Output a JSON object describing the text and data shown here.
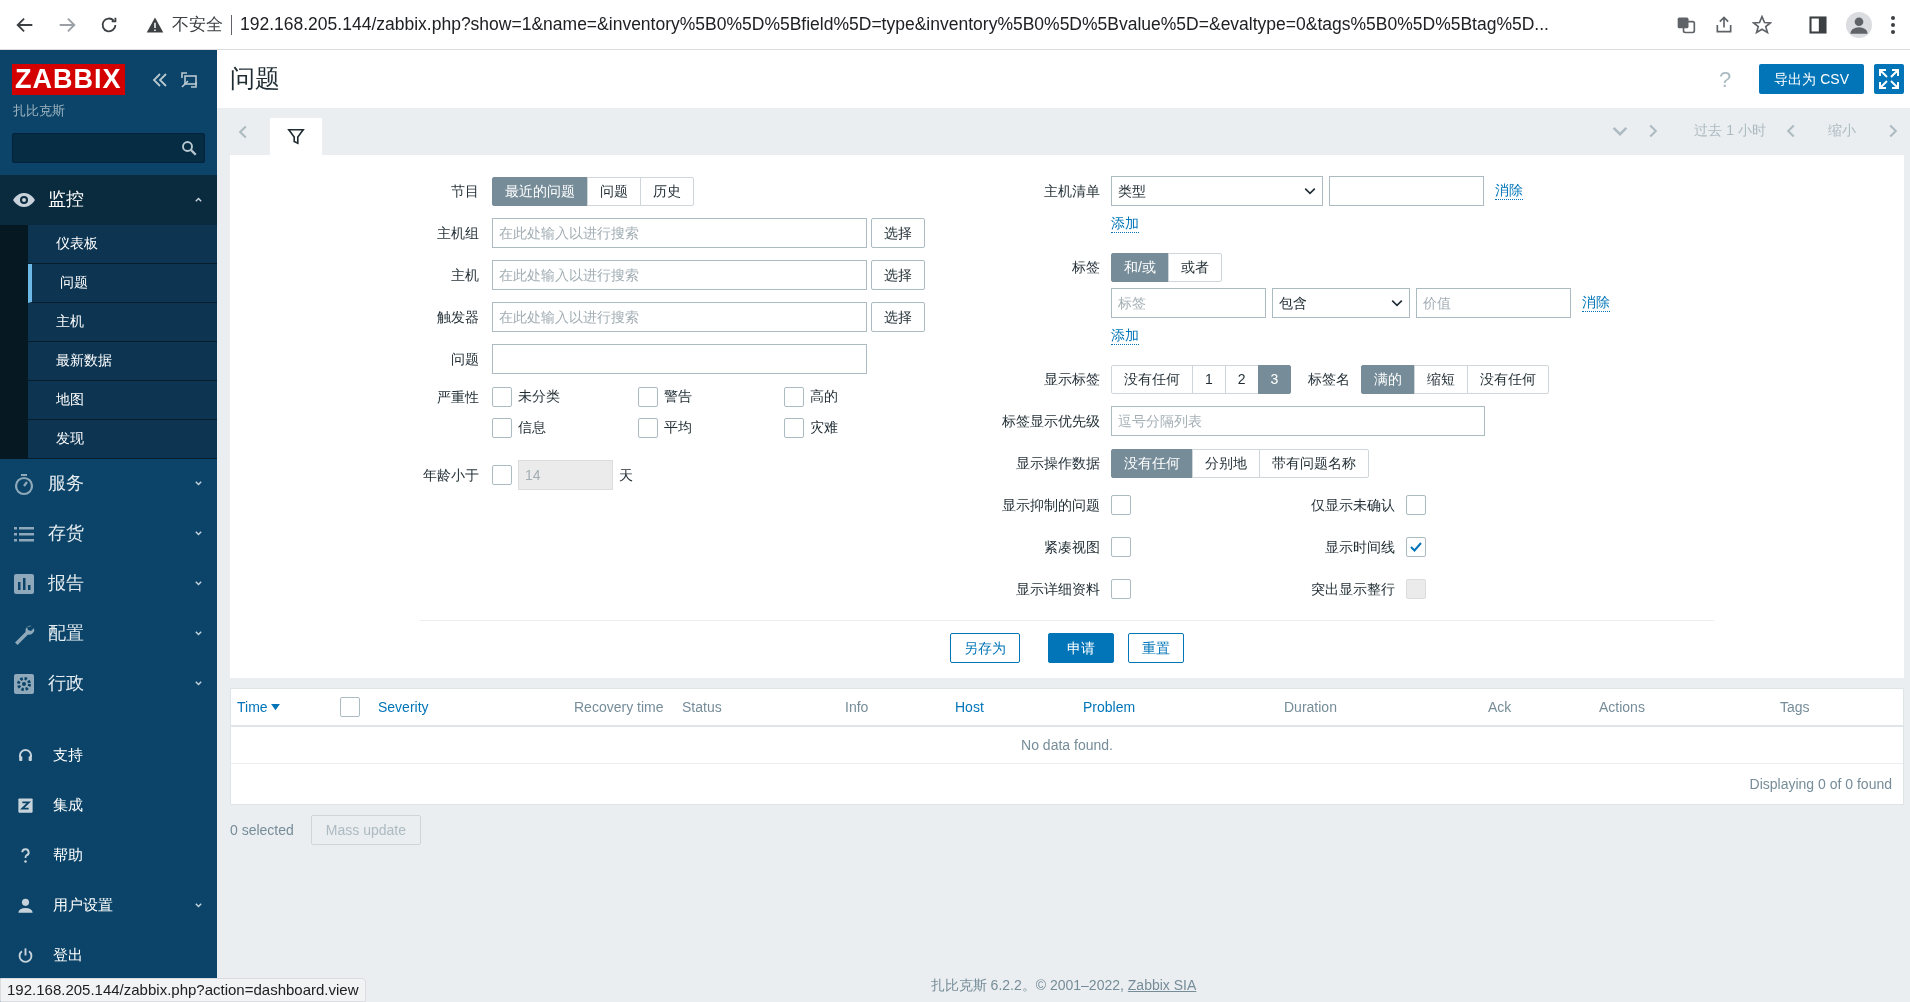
{
  "browser": {
    "security_label": "不安全",
    "url": "192.168.205.144/zabbix.php?show=1&name=&inventory%5B0%5D%5Bfield%5D=type&inventory%5B0%5D%5Bvalue%5D=&evaltype=0&tags%5B0%5D%5Btag%5D..."
  },
  "sidebar": {
    "logo": "ZABBIX",
    "subtitle": "扎比克斯",
    "menu": [
      {
        "label": "监控",
        "expanded": true,
        "children": [
          {
            "label": "仪表板",
            "selected": false
          },
          {
            "label": "问题",
            "selected": true
          },
          {
            "label": "主机",
            "selected": false
          },
          {
            "label": "最新数据",
            "selected": false
          },
          {
            "label": "地图",
            "selected": false
          },
          {
            "label": "发现",
            "selected": false
          }
        ]
      },
      {
        "label": "服务",
        "expanded": false
      },
      {
        "label": "存货",
        "expanded": false
      },
      {
        "label": "报告",
        "expanded": false
      },
      {
        "label": "配置",
        "expanded": false
      },
      {
        "label": "行政",
        "expanded": false
      }
    ],
    "bottom": [
      {
        "label": "支持"
      },
      {
        "label": "集成"
      },
      {
        "label": "帮助"
      },
      {
        "label": "用户设置",
        "expanded": false
      },
      {
        "label": "登出"
      }
    ]
  },
  "header": {
    "title": "问题",
    "help": "?",
    "export_button": "导出为 CSV"
  },
  "timeline": {
    "period": "过去 1 小时",
    "zoom_out": "缩小"
  },
  "filter": {
    "left": {
      "show": {
        "label": "节目",
        "options": [
          {
            "label": "最近的问题",
            "selected": true
          },
          {
            "label": "问题",
            "selected": false
          },
          {
            "label": "历史",
            "selected": false
          }
        ]
      },
      "multiselects": [
        {
          "label": "主机组",
          "placeholder": "在此处输入以进行搜索",
          "button": "选择"
        },
        {
          "label": "主机",
          "placeholder": "在此处输入以进行搜索",
          "button": "选择"
        },
        {
          "label": "触发器",
          "placeholder": "在此处输入以进行搜索",
          "button": "选择"
        }
      ],
      "problem": {
        "label": "问题"
      },
      "severity": {
        "label": "严重性",
        "options": [
          {
            "label": "未分类",
            "checked": false
          },
          {
            "label": "警告",
            "checked": false
          },
          {
            "label": "高的",
            "checked": false
          },
          {
            "label": "信息",
            "checked": false
          },
          {
            "label": "平均",
            "checked": false
          },
          {
            "label": "灾难",
            "checked": false
          }
        ]
      },
      "age": {
        "label": "年龄小于",
        "checked": false,
        "value": "14",
        "unit": "天"
      }
    },
    "right": {
      "inventory": {
        "label": "主机清单",
        "field": "类型",
        "remove": "消除",
        "add": "添加"
      },
      "tags": {
        "label": "标签",
        "evaltype": [
          {
            "label": "和/或",
            "selected": true
          },
          {
            "label": "或者",
            "selected": false
          }
        ],
        "tag_placeholder": "标签",
        "operator": "包含",
        "value_placeholder": "价值",
        "remove": "消除",
        "add": "添加"
      },
      "show_tags": {
        "label": "显示标签",
        "options": [
          {
            "label": "没有任何",
            "selected": false
          },
          {
            "label": "1",
            "selected": false
          },
          {
            "label": "2",
            "selected": false
          },
          {
            "label": "3",
            "selected": true
          }
        ]
      },
      "tag_name": {
        "label": "标签名",
        "options": [
          {
            "label": "满的",
            "selected": true
          },
          {
            "label": "缩短",
            "selected": false
          },
          {
            "label": "没有任何",
            "selected": false
          }
        ]
      },
      "tag_priority": {
        "label": "标签显示优先级",
        "placeholder": "逗号分隔列表"
      },
      "show_opdata": {
        "label": "显示操作数据",
        "options": [
          {
            "label": "没有任何",
            "selected": true
          },
          {
            "label": "分别地",
            "selected": false
          },
          {
            "label": "带有问题名称",
            "selected": false
          }
        ]
      },
      "checkboxes": [
        {
          "label": "显示抑制的问题",
          "checked": false,
          "disabled": false
        },
        {
          "label": "仅显示未确认",
          "checked": false,
          "disabled": false
        },
        {
          "label": "紧凑视图",
          "checked": false,
          "disabled": false
        },
        {
          "label": "显示时间线",
          "checked": true,
          "disabled": false
        },
        {
          "label": "显示详细资料",
          "checked": false,
          "disabled": false
        },
        {
          "label": "突出显示整行",
          "checked": false,
          "disabled": true
        }
      ]
    },
    "buttons": [
      {
        "label": "另存为",
        "primary": false
      },
      {
        "label": "申请",
        "primary": true
      },
      {
        "label": "重置",
        "primary": false
      }
    ]
  },
  "table": {
    "columns": [
      {
        "kind": "text",
        "label": "Time",
        "link": true,
        "sorted": true
      },
      {
        "kind": "checkbox",
        "checked": false
      },
      {
        "kind": "text",
        "label": "Severity",
        "link": true,
        "sorted": false
      },
      {
        "kind": "text",
        "label": "Recovery time",
        "link": false,
        "sorted": false
      },
      {
        "kind": "text",
        "label": "Status",
        "link": false,
        "sorted": false
      },
      {
        "kind": "text",
        "label": "Info",
        "link": false,
        "sorted": false
      },
      {
        "kind": "text",
        "label": "Host",
        "link": true,
        "sorted": false
      },
      {
        "kind": "text",
        "label": "Problem",
        "link": true,
        "sorted": false
      },
      {
        "kind": "text",
        "label": "Duration",
        "link": false,
        "sorted": false
      },
      {
        "kind": "text",
        "label": "Ack",
        "link": false,
        "sorted": false
      },
      {
        "kind": "text",
        "label": "Actions",
        "link": false,
        "sorted": false
      },
      {
        "kind": "text",
        "label": "Tags",
        "link": false,
        "sorted": false
      }
    ],
    "empty": "No data found.",
    "summary": "Displaying 0 of 0 found"
  },
  "selection": {
    "count": "0 selected",
    "mass_update": "Mass update",
    "disabled": true
  },
  "footer": {
    "text": "扎比克斯 6.2.2。© 2001–2022, ",
    "link": "Zabbix SIA"
  },
  "status_url": "192.168.205.144/zabbix.php?action=dashboard.view"
}
